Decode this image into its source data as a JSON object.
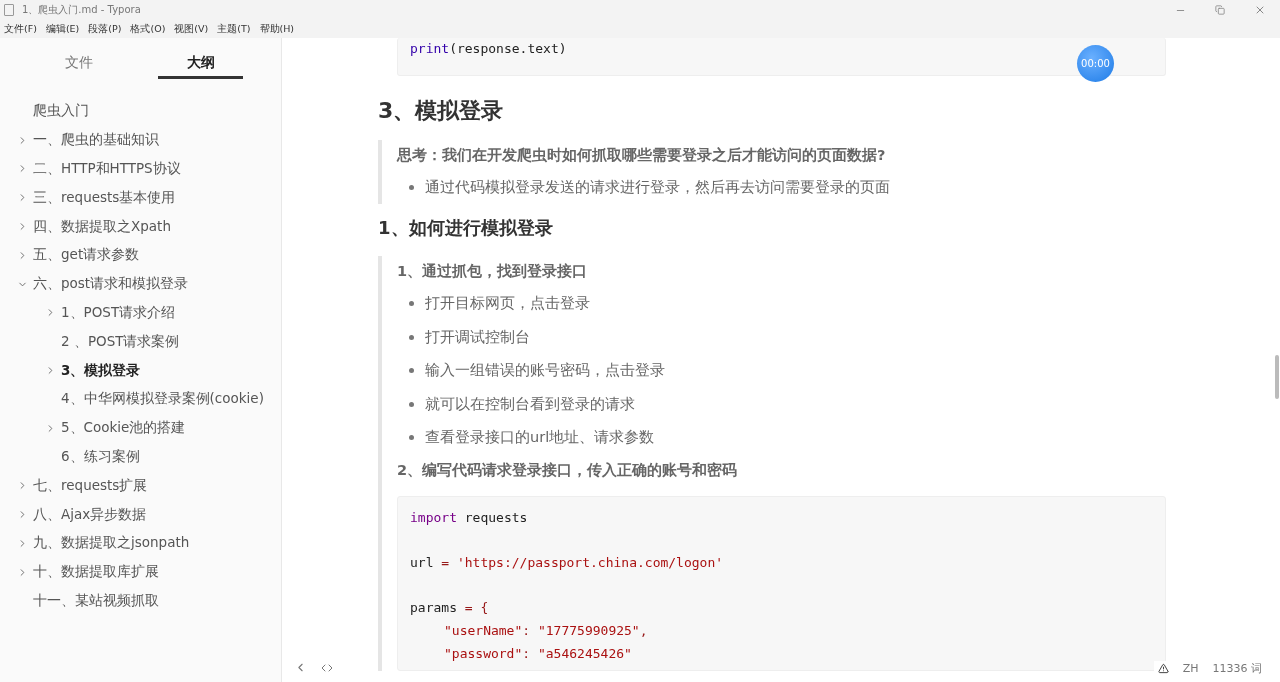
{
  "window": {
    "title": "1、爬虫入门.md - Typora"
  },
  "menu": [
    "文件(F)",
    "编辑(E)",
    "段落(P)",
    "格式(O)",
    "视图(V)",
    "主题(T)",
    "帮助(H)"
  ],
  "sidebar": {
    "tabs": [
      {
        "label": "文件",
        "selected": false
      },
      {
        "label": "大纲",
        "selected": true
      }
    ],
    "outline": [
      {
        "label": "爬虫入门",
        "kind": "leaf",
        "selected": false
      },
      {
        "label": "一、爬虫的基础知识",
        "kind": "branch",
        "expanded": false,
        "selected": false
      },
      {
        "label": "二、HTTP和HTTPS协议",
        "kind": "branch",
        "expanded": false,
        "selected": false
      },
      {
        "label": "三、requests基本使用",
        "kind": "branch",
        "expanded": false,
        "selected": false
      },
      {
        "label": "四、数据提取之Xpath",
        "kind": "branch",
        "expanded": false,
        "selected": false
      },
      {
        "label": "五、get请求参数",
        "kind": "branch",
        "expanded": false,
        "selected": false
      },
      {
        "label": "六、post请求和模拟登录",
        "kind": "branch",
        "expanded": true,
        "selected": false,
        "children": [
          {
            "label": "1、POST请求介绍",
            "kind": "branch",
            "expanded": false,
            "selected": false
          },
          {
            "label": "2 、POST请求案例",
            "kind": "leaf",
            "selected": false
          },
          {
            "label": "3、模拟登录",
            "kind": "branch",
            "expanded": false,
            "selected": true
          },
          {
            "label": "4、中华网模拟登录案例(cookie)",
            "kind": "leaf",
            "selected": false
          },
          {
            "label": "5、Cookie池的搭建",
            "kind": "branch",
            "expanded": false,
            "selected": false
          },
          {
            "label": "6、练习案例",
            "kind": "leaf",
            "selected": false
          }
        ]
      },
      {
        "label": "七、requests扩展",
        "kind": "branch",
        "expanded": false,
        "selected": false
      },
      {
        "label": "八、Ajax异步数据",
        "kind": "branch",
        "expanded": false,
        "selected": false
      },
      {
        "label": "九、数据提取之jsonpath",
        "kind": "branch",
        "expanded": false,
        "selected": false
      },
      {
        "label": "十、数据提取库扩展",
        "kind": "branch",
        "expanded": false,
        "selected": false
      },
      {
        "label": "十一、某站视频抓取",
        "kind": "leaf",
        "selected": false
      }
    ]
  },
  "document": [
    {
      "kind": "code_tail",
      "lines": [
        {
          "kind": "code",
          "tokens": [
            {
              "kind": "builtin",
              "text": "print"
            },
            {
              "kind": "plain",
              "text": "(response.text)"
            }
          ]
        }
      ]
    },
    {
      "kind": "h2",
      "text": "3、模拟登录"
    },
    {
      "kind": "quote",
      "blocks": [
        {
          "kind": "strong",
          "text": "思考：我们在开发爬虫时如何抓取哪些需要登录之后才能访问的页面数据?"
        },
        {
          "kind": "bullet",
          "text": "通过代码模拟登录发送的请求进行登录，然后再去访问需要登录的页面"
        }
      ]
    },
    {
      "kind": "h3",
      "text": "1、如何进行模拟登录"
    },
    {
      "kind": "quote",
      "blocks": [
        {
          "kind": "strong",
          "text": "1、通过抓包，找到登录接口"
        },
        {
          "kind": "bullet",
          "text": "打开目标网页，点击登录"
        },
        {
          "kind": "bullet",
          "text": "打开调试控制台"
        },
        {
          "kind": "bullet",
          "text": "输入一组错误的账号密码，点击登录"
        },
        {
          "kind": "bullet",
          "text": "就可以在控制台看到登录的请求"
        },
        {
          "kind": "bullet",
          "text": "查看登录接口的url地址、请求参数"
        },
        {
          "kind": "strong",
          "text": "2、编写代码请求登录接口，传入正确的账号和密码"
        },
        {
          "kind": "code",
          "lines": [
            {
              "kind": "code",
              "tokens": [
                {
                  "kind": "keyword",
                  "text": "import"
                },
                {
                  "kind": "plain",
                  "text": " requests"
                }
              ]
            },
            {
              "kind": "blank"
            },
            {
              "kind": "code",
              "tokens": [
                {
                  "kind": "plain",
                  "text": "url "
                },
                {
                  "kind": "operator",
                  "text": "= "
                },
                {
                  "kind": "string",
                  "text": "'https://passport.china.com/logon'"
                }
              ]
            },
            {
              "kind": "blank"
            },
            {
              "kind": "code",
              "tokens": [
                {
                  "kind": "plain",
                  "text": "params "
                },
                {
                  "kind": "operator",
                  "text": "= {"
                }
              ]
            },
            {
              "kind": "indented",
              "tokens": [
                {
                  "kind": "string",
                  "text": "\"userName\""
                },
                {
                  "kind": "operator",
                  "text": ": "
                },
                {
                  "kind": "string",
                  "text": "\"17775990925\""
                },
                {
                  "kind": "operator",
                  "text": ","
                }
              ]
            },
            {
              "kind": "indented",
              "tokens": [
                {
                  "kind": "string",
                  "text": "\"password\""
                },
                {
                  "kind": "operator",
                  "text": ": "
                },
                {
                  "kind": "string",
                  "text": "\"a546245426\""
                }
              ]
            }
          ]
        }
      ]
    }
  ],
  "recording_badge": "00:00",
  "status_bar": {
    "language": "ZH",
    "word_count": "11336 词"
  }
}
